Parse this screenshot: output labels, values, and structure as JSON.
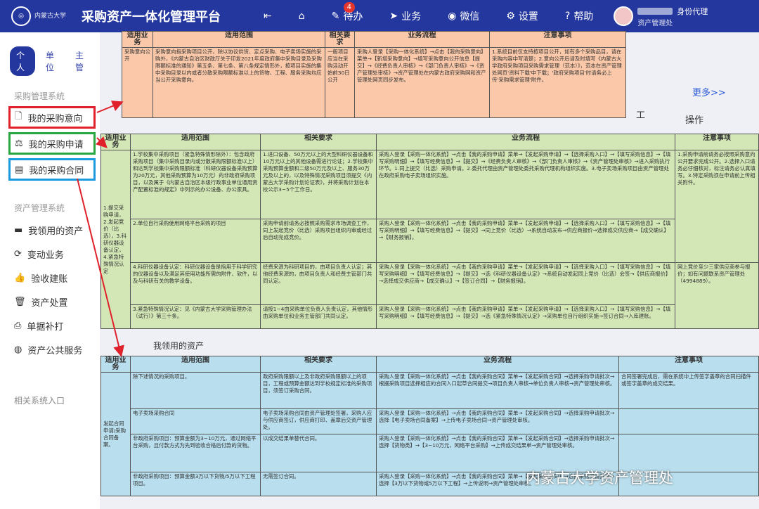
{
  "header": {
    "university": "内蒙古大学",
    "title": "采购资产一体化管理平台",
    "nav": [
      {
        "label": "",
        "icon": "collapse-icon"
      },
      {
        "label": "",
        "icon": "home-icon"
      },
      {
        "label": "待办",
        "icon": "edit-icon",
        "badge": "4"
      },
      {
        "label": "业务",
        "icon": "send-icon"
      },
      {
        "label": "微信",
        "icon": "wechat-icon"
      },
      {
        "label": "设置",
        "icon": "gear-icon"
      },
      {
        "label": "帮助",
        "icon": "help-icon"
      }
    ],
    "user_role": "身份代理",
    "user_dept": "资产管理处"
  },
  "sidebar": {
    "tabs": [
      "个人",
      "单位",
      "主管"
    ],
    "group1": "采购管理系统",
    "items1": [
      "我的采购意向",
      "我的采购申请",
      "我的采购合同"
    ],
    "group2": "资产管理系统",
    "items2": [
      "我领用的资产",
      "变动业务",
      "验收建账",
      "资产处置",
      "单据补打",
      "资产公共服务"
    ],
    "footer": "相关系统入口"
  },
  "main": {
    "more": "更多>>",
    "work": "工",
    "op": "操作",
    "received": "我领用的资产"
  },
  "table1": {
    "headers": [
      "适用业务",
      "适用范围",
      "相关要求",
      "业务流程",
      "注意事项"
    ],
    "row": [
      "采购意向公开",
      "采购意向指采购项目公开，除以协议供货、定点采购、电子卖场实施的采购外，《内蒙古自治区财政厅关于印发2021年度政府集中采购目录及采购限额标准的通知》第五条、第七条、第八条规定情形外，按项目实施的集中采购目录以内或者分散采购限额标准以上的货物、工程、服务采购均应当公开采购意向。",
      "一般项目应当在采购活动开始前30日公开",
      "采购人登录【采购一体化系统】→点击【我的采购意向】菜单→【新增采购意向】→填写采购意向公开信息【提交】→《经费负责人审核》→《部门负责人审核》→《资产管理处审核》→资产管理处在内蒙古政府采购网和资产管理处网页同步发布。",
      "1.系统目前仅支持按项目公开，如有多个采购品目，请在采购内容中写清楚；2.意向公开后请及时填写《内蒙古大学政府采购项目采购需求管理（范本）》，范本在资产管理处网页'资料下载'中下载；'政府采购项目'时请务必上传'采购需求管理'附件。"
    ]
  },
  "table2": {
    "headers": [
      "适用业务",
      "适用范围",
      "相关要求",
      "业务流程",
      "注意事项"
    ],
    "biz": "1.提交采购申请，2.发起竞价（比选），3.科研仪器设备认定，4.紧急特殊情况认定",
    "rows": [
      [
        "1.学校集中采购项目（紧急特殊情形除外）：包含政府采购项目（集中采购目录内或分散采购限额标准以上）和达到学校集中采购限额标准（科研仪器设备采购预算为20万元，其他采购预算为10万元）的非政府采购项目，以及属于《内蒙古自治区本级行政事业单位通用资产配置标准的规定》中列示的办公设备、办公家具。",
        "1.进口设备、50万元以上的大型科研仪器设备和10万元以上的其他设备需进行论证；2.学校集中采购预算金额和二级50万元及以上、服务30万元及以上的，以及特殊情况采购项目须提交《内蒙古大学采购计划论证表》，并将采购计划在本校公示3~5个工作日。",
        "采购人登录【采购一体化系统】→点击【我的采购申请】菜单→【发起采购申请】→【选择采购入口】→【填写采购信息】→【填写采购明细】→【填写经费信息】→【提交】→《经费负责人审核》→《部门负责人审核》→《资产管理处审核》→进入采购执行环节。1.同上提交（比选）采购申请。2.委托代理由资产管理处委托采购代理机构组织实施。3.电子卖场采购项目由资产管理处在政府采购电子卖场组织实施。",
        "1.采购申请前请务必按照采购意向公开要求完成公开。2.选择入口请务必仔细核对，标注请务必认真填写。3.特定采购须在申请前上传相关附件。"
      ],
      [
        "2.单位自行采购使用网络平台采购的项目",
        "采购申请前请务必按照采购需求市场调查工作，同上发起竞价（比选）采购项目组织内审或经过后自动完成竞价。",
        "采购人登录【采购一体化系统】→点击【我的采购申请】菜单→【发起采购申请】→【选择采购入口】→【填写采购信息】→【填写采购明细】→【填写经费信息】→【提交】→同上竞价（比选）→系统自动发布→供应商报价→选择成交供应商→【成交确认】→【财务报销】。",
        "网上竞价至少三家供应商参与报价；如有问题联系资产管理处（4994889）。"
      ],
      [
        "4.科研仪器设备认定：科研仪器设备是指用于科学研究的仪器设备以及满足其使用功能所需的附件、软件，以及与科研有关的教学设备。",
        "经费来源为科研项目的，由项目负责人认定；其他经费来源的，由项目负责人和经费主管部门共同认定。",
        "采购人登录【采购一体化系统】→点击【我的采购申请】菜单→【发起采购申请】→【选择采购入口】→【填写采购信息】→【填写采购明细】→【填写经费信息】→【提交】→选《科研仪器设备认定》→系统自动发起同上竞价（比选）会签→【供应商报价】→选择成交供应商→【成交确认】→【签订合同】→【财务报销】。",
        ""
      ],
      [
        "3.紧急特殊情况认定：见《内蒙古大学采购管理办法（试行）》第三十条。",
        "请按1~4由采购单位负责人负责认定，其他情形由采购单位和业务主管部门共同认定。",
        "采购人登录【采购一体化系统】→点击【我的采购申请】菜单→【发起采购申请】→【选择采购入口】→【填写采购信息】→【填写采购明细】→【填写经费信息】→【提交】→选《紧急特殊情况认定》→采购单位自行组织实施→签订合同→入库建账。",
        ""
      ]
    ]
  },
  "table3": {
    "headers": [
      "适用业务",
      "适用范围",
      "相关要求",
      "业务流程",
      "注意事项"
    ],
    "biz": "发起合同申请/采购合同备案。",
    "rows": [
      [
        "除下述情况的采购项目。",
        "政府采购限额以上及非政府采购限额以上的项目，工程或预算金额达到学校规定标准的采购项目，须签订采购合同。",
        "采购人登录【采购一体化系统】→点击【我的采购合同】菜单→【发起采购合同】→选择采购申请批次→根据采购项目选择相应的合同入口起草合同提交→项目负责人审核→单位负责人审核→资产管理处审核。",
        "合同签署完成后，需在系统中上传签字盖章的合同扫描件或签字盖章的成交结果。"
      ],
      [
        "电子卖场采购合同",
        "电子卖场采购合同由资产管理处签署，采购人应与供应商签订，供应商打印、盖章后交资产管理处。",
        "采购人登录【采购一体化系统】→点击【我的采购合同】菜单→【发起采购合同】→选择采购申请批次→选择【电子卖场合同备案】→上传电子卖场合同→资产管理处审核。",
        ""
      ],
      [
        "非政府采购项目：预算金额为3~10万元，通过网络平台采购，且付款方式为先到验收合格后付款的货物。",
        "以成交结果单替代合同。",
        "采购人登录【采购一体化系统】→点击【我的采购合同】菜单→【发起采购合同】→选择采购申请批次→选择【货物类】→【3~10万元，网络平台采购】→上传成交结果单→资产管理处审核。",
        ""
      ],
      [
        "非政府采购项目：预算金额3万以下货物/5万以下工程项目。",
        "无需签订合同。",
        "采购人登录【采购一体化系统】→点击【我的采购合同】菜单→【发起采购合同】→选择采购申请批次→选择【3万以下货物或5万以下工程】→上传说明→资产管理处审核。",
        ""
      ]
    ]
  },
  "watermark": "内蒙古大学资产管理处",
  "colors": {
    "topbar": "#24379f",
    "orange": "#fbc9a9",
    "green": "#d3e7b6",
    "blue": "#b9dfee",
    "red": "#e0202a",
    "greenbox": "#28a745",
    "bluebox": "#1a9be0"
  }
}
